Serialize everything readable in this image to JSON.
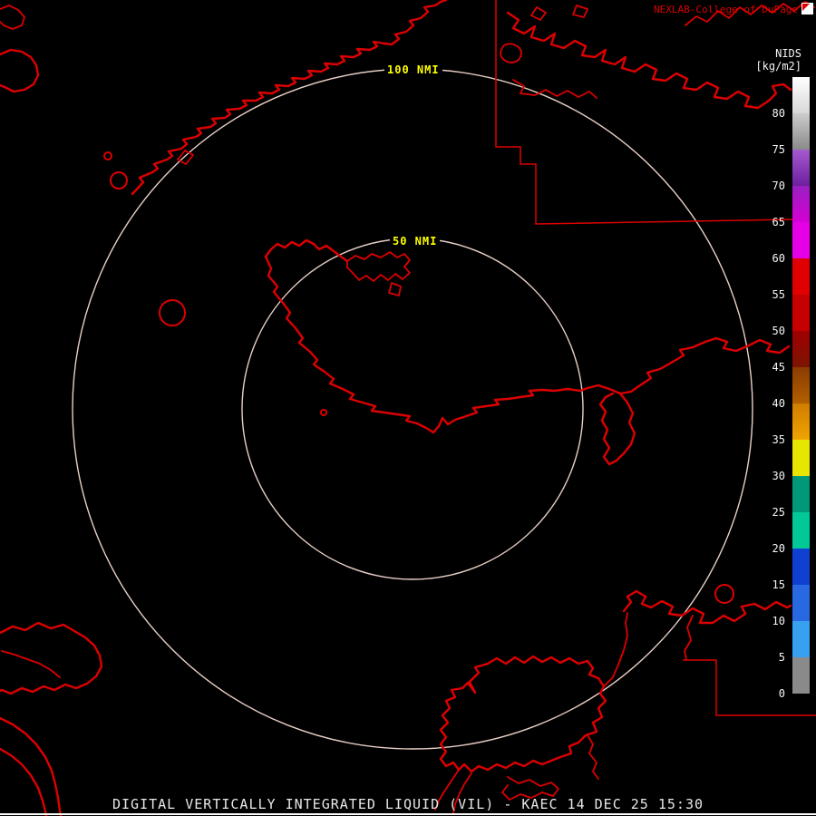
{
  "header": {
    "brand": "NEXLAB-College of DuPage",
    "logo_icon": "cod-pennant-icon"
  },
  "colorbar": {
    "title": "NIDS",
    "units": "[kg/m2]",
    "ticks": [
      "80",
      "75",
      "70",
      "65",
      "60",
      "55",
      "50",
      "45",
      "40",
      "35",
      "30",
      "25",
      "20",
      "15",
      "10",
      "5",
      "0"
    ],
    "segments": [
      "linear-gradient(#ffffff,#d8d8d8)",
      "linear-gradient(#cccccc,#8a8a8a)",
      "linear-gradient(#a55ad0,#6d1f9e)",
      "linear-gradient(#9a20c0,#d400d4)",
      "#e600e6",
      "#e00000",
      "#c60000",
      "linear-gradient(#a00000,#7c1400)",
      "linear-gradient(#8a3c00,#b35f00)",
      "linear-gradient(#d07c00,#f0a400)",
      "#e6e600",
      "#009878",
      "#00c896",
      "#1040d0",
      "#2868e0",
      "#38a0f0",
      "#8a8a8a"
    ]
  },
  "rings": {
    "outer_label": "100 NMI",
    "inner_label": "50 NMI"
  },
  "footer": {
    "product_title": "DIGITAL VERTICALLY INTEGRATED LIQUID (VIL) - KAEC 14 DEC 25 15:30"
  },
  "colors": {
    "background": "#000000",
    "map_outline": "#dd0000",
    "range_ring": "#e8d0c6",
    "ring_label": "#ffff00",
    "brand_text": "#dd0000",
    "scale_text": "#f5f5f5"
  }
}
